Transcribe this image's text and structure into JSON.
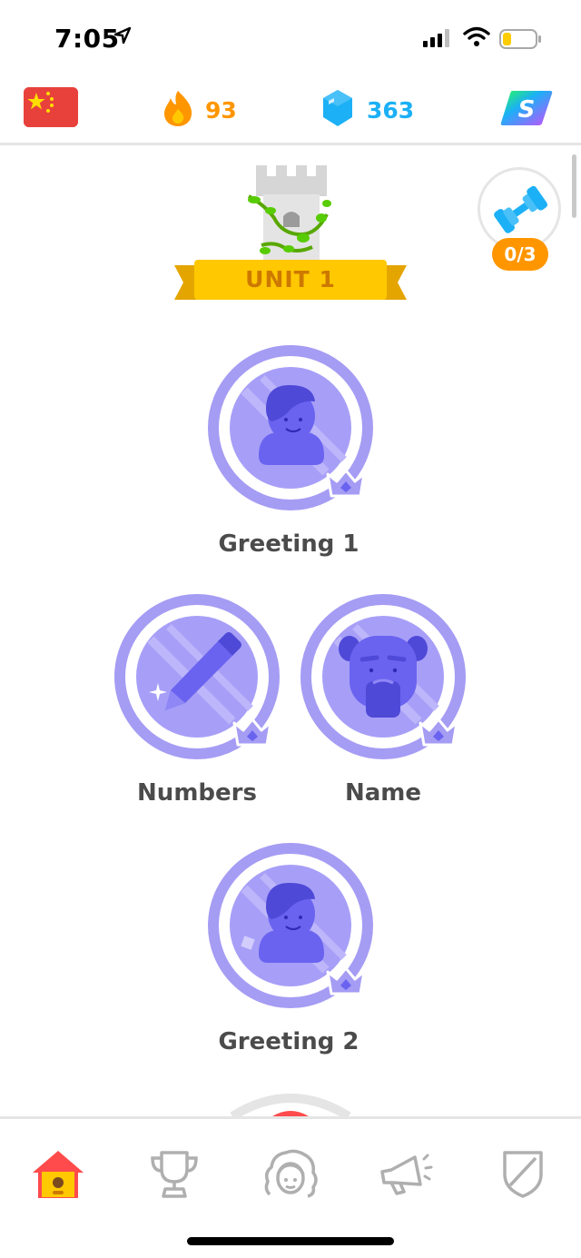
{
  "status_bar": {
    "time": "7:05",
    "icons": [
      "location-arrow-icon",
      "cellular-signal-icon",
      "wifi-icon",
      "battery-low-icon"
    ]
  },
  "top_bar": {
    "course_flag": "china-flag-icon",
    "streak": {
      "icon": "flame-icon",
      "count": "93",
      "color": "#ff9600"
    },
    "gems": {
      "icon": "gem-icon",
      "count": "363",
      "color": "#1cb0f6"
    },
    "super": {
      "icon": "super-badge-icon"
    }
  },
  "unit": {
    "icon": "castle-icon",
    "label": "UNIT 1"
  },
  "practice": {
    "icon": "dumbbell-icon",
    "progress": "0/3",
    "completed": 0,
    "total": 3
  },
  "skills": [
    {
      "title": "Greeting 1",
      "icon": "person-icon",
      "crowned": true
    },
    {
      "title": "Numbers",
      "icon": "pencil-icon",
      "crowned": true
    },
    {
      "title": "Name",
      "icon": "old-man-icon",
      "crowned": true
    },
    {
      "title": "Greeting 2",
      "icon": "person-icon",
      "crowned": true
    }
  ],
  "tabs": [
    {
      "name": "learn",
      "icon": "home-icon",
      "active": true
    },
    {
      "name": "leaderboards",
      "icon": "trophy-icon",
      "active": false
    },
    {
      "name": "profile",
      "icon": "profile-icon",
      "active": false
    },
    {
      "name": "news",
      "icon": "megaphone-icon",
      "active": false
    },
    {
      "name": "shop",
      "icon": "shield-icon",
      "active": false
    }
  ],
  "colors": {
    "accent_purple": "#ce82ff",
    "skill_purple": "#a59cf4",
    "skill_inner": "#8f87f5",
    "gold": "#ffc800",
    "orange": "#ff9600",
    "blue": "#1cb0f6",
    "red": "#ff4b4b"
  }
}
